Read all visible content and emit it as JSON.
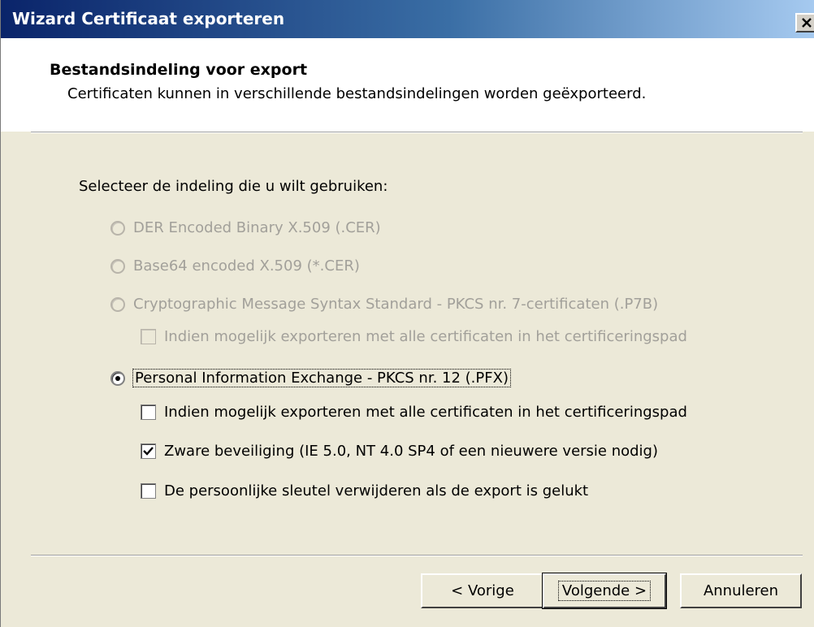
{
  "window": {
    "title": "Wizard Certificaat exporteren"
  },
  "header": {
    "title": "Bestandsindeling voor export",
    "subtitle": "Certificaten kunnen in verschillende bestandsindelingen worden geëxporteerd."
  },
  "prompt": "Selecteer de indeling die u wilt gebruiken:",
  "formats": [
    {
      "label": "DER Encoded Binary X.509 (.CER)",
      "selected": false,
      "enabled": false
    },
    {
      "label": "Base64 encoded X.509 (*.CER)",
      "selected": false,
      "enabled": false
    },
    {
      "label": "Cryptographic Message Syntax Standard - PKCS nr. 7-certificaten (.P7B)",
      "selected": false,
      "enabled": false
    },
    {
      "label": "Personal Information Exchange - PKCS nr. 12 (.PFX)",
      "selected": true,
      "enabled": true
    }
  ],
  "p7b_options": [
    {
      "label": "Indien mogelijk exporteren met alle certificaten in het certificeringspad",
      "checked": false,
      "enabled": false
    }
  ],
  "pfx_options": [
    {
      "label": "Indien mogelijk exporteren met alle certificaten in het certificeringspad",
      "checked": false,
      "enabled": true
    },
    {
      "label": "Zware beveiliging (IE 5.0, NT 4.0 SP4 of een nieuwere versie nodig)",
      "checked": true,
      "enabled": true
    },
    {
      "label": "De persoonlijke sleutel verwijderen als de export is gelukt",
      "checked": false,
      "enabled": true
    }
  ],
  "buttons": {
    "back": "< Vorige",
    "next": "Volgende >",
    "cancel": "Annuleren"
  }
}
